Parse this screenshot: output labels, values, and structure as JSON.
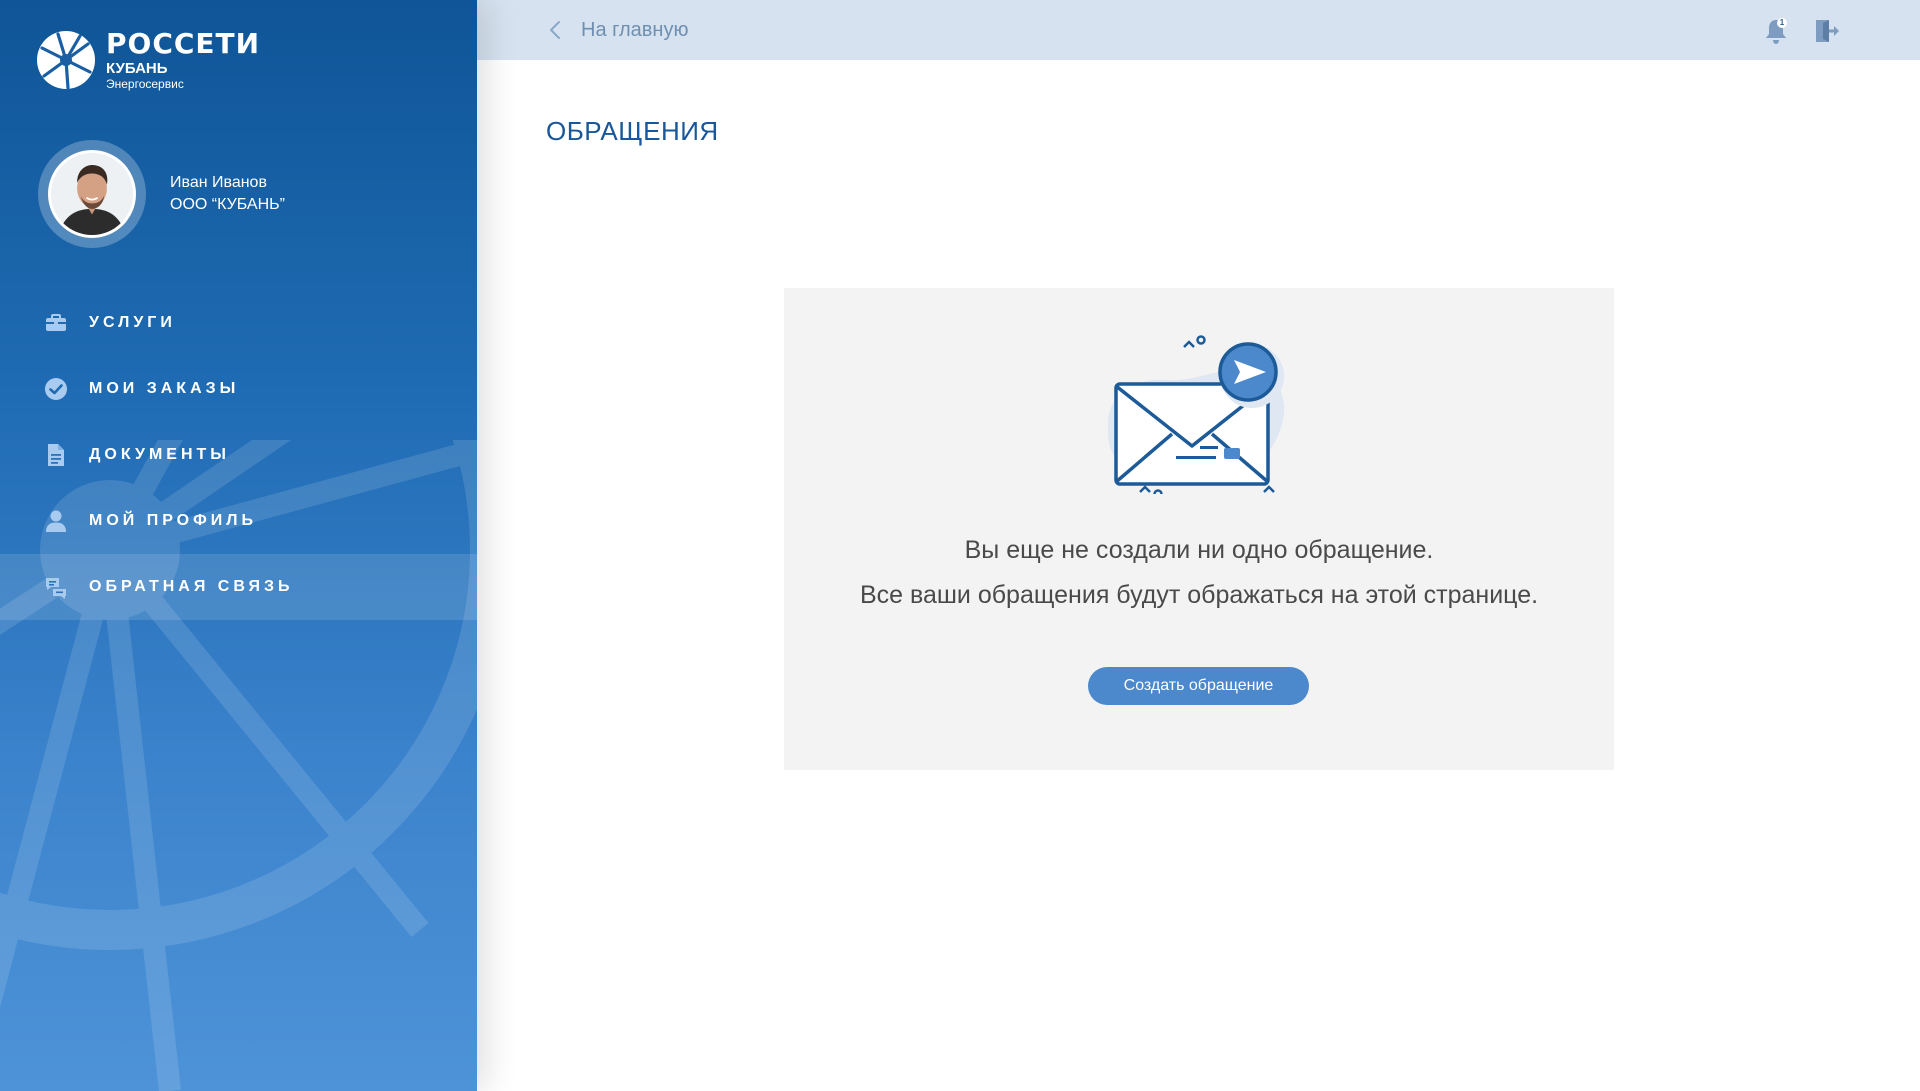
{
  "brand": {
    "line1": "РОССЕТИ",
    "line2": "КУБАНЬ",
    "line3": "Энергосервис",
    "logo_icon": "rosseti-logo-icon"
  },
  "user": {
    "name": "Иван Иванов",
    "company": "ООО “КУБАНЬ”",
    "avatar_icon": "user-avatar-photo"
  },
  "nav": {
    "items": [
      {
        "label": "УСЛУГИ",
        "icon": "briefcase-icon",
        "active": false
      },
      {
        "label": "МОИ ЗАКАЗЫ",
        "icon": "check-circle-icon",
        "active": false
      },
      {
        "label": "ДОКУМЕНТЫ",
        "icon": "document-icon",
        "active": false
      },
      {
        "label": "МОЙ ПРОФИЛЬ",
        "icon": "user-icon",
        "active": false
      },
      {
        "label": "ОБРАТНАЯ СВЯЗЬ",
        "icon": "chat-bubbles-icon",
        "active": true
      }
    ]
  },
  "topbar": {
    "back_label": "На главную",
    "notifications_count": "1"
  },
  "page": {
    "title": "ОБРАЩЕНИЯ"
  },
  "empty_state": {
    "line1": "Вы еще не создали ни одно обращение.",
    "line2": "Все ваши обращения будут ображаться на этой странице.",
    "button_label": "Создать обращение"
  },
  "colors": {
    "sidebar_top": "#0f5597",
    "sidebar_bottom": "#4e93d8",
    "topbar_bg": "#d6e2ef",
    "accent": "#4b88cc",
    "title": "#17579a",
    "card_bg": "#f3f3f3"
  }
}
